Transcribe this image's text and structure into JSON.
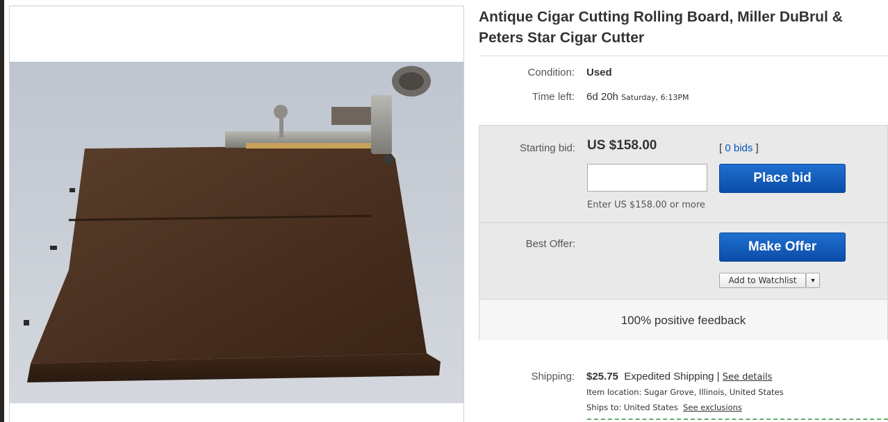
{
  "listing": {
    "title": "Antique Cigar Cutting Rolling Board, Miller DuBrul & Peters Star Cigar Cutter",
    "condition_label": "Condition:",
    "condition_value": "Used",
    "time_left_label": "Time left:",
    "time_left_value": "6d 20h",
    "time_left_end": "Saturday, 6:13PM"
  },
  "bidding": {
    "starting_bid_label": "Starting bid:",
    "starting_bid_value": "US $158.00",
    "bids_open": "[ ",
    "bids_link": "0 bids",
    "bids_close": " ]",
    "bid_input_value": "",
    "place_bid_label": "Place bid",
    "hint": "Enter US $158.00 or more",
    "best_offer_label": "Best Offer:",
    "make_offer_label": "Make Offer",
    "watchlist_label": "Add to Watchlist",
    "watchlist_dropdown_icon": "caret-down-icon",
    "feedback_text": "100% positive feedback"
  },
  "shipping": {
    "label": "Shipping:",
    "price": "$25.75",
    "method": "Expedited Shipping",
    "separator": "|",
    "details_link": "See details",
    "location_label": "Item location:",
    "location_value": "Sugar Grove, Illinois, United States",
    "ships_to_label": "Ships to:",
    "ships_to_value": "United States",
    "exclusions_link": "See exclusions"
  },
  "colors": {
    "button_blue": "#0b4da8",
    "link_blue": "#0654ba",
    "panel_gray": "#e9e9e9"
  }
}
